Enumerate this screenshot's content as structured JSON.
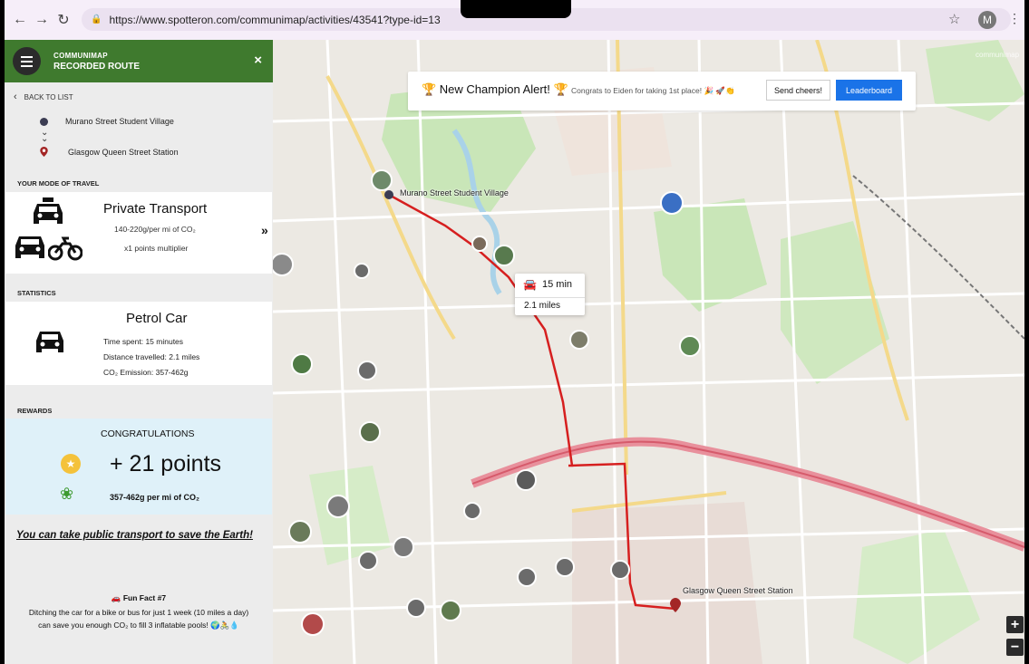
{
  "browser": {
    "url": "https://www.spotteron.com/communimap/activities/43541?type-id=13",
    "profile_initial": "M"
  },
  "sidebar": {
    "app_name": "COMMUNIMAP",
    "title": "RECORDED ROUTE",
    "close_label": "×",
    "back_label": "BACK TO LIST",
    "route": {
      "origin": "Murano Street Student Village",
      "destination": "Glasgow Queen Street Station"
    },
    "mode": {
      "section_label": "YOUR MODE OF TRAVEL",
      "title": "Private Transport",
      "co2": "140-220g/per mi of CO₂",
      "multiplier": "x1 points multiplier",
      "next_label": "»"
    },
    "statistics": {
      "section_label": "STATISTICS",
      "title": "Petrol Car",
      "time": "Time spent: 15 minutes",
      "distance": "Distance travelled: 2.1 miles",
      "emission": "CO₂ Emission: 357-462g"
    },
    "rewards": {
      "section_label": "REWARDS",
      "congrats": "CONGRATULATIONS",
      "points": "+ 21 points",
      "co2": "357-462g per mi of CO₂"
    },
    "tip": "You can take public transport to save the Earth!",
    "fun_fact": {
      "title": "🚗 Fun Fact #7",
      "body": "Ditching the car for a bike or bus for just 1 week (10 miles a day) can save you enough CO₂ to fill 3 inflatable pools! 🌍🚴💧"
    }
  },
  "map": {
    "alert": {
      "title": "🏆 New Champion Alert! 🏆",
      "subtitle": "Congrats to Eiden for taking 1st place! 🎉 🚀👏",
      "cheers_label": "Send cheers!",
      "leaderboard_label": "Leaderboard"
    },
    "tooltip": {
      "time": "15 min",
      "distance": "2.1 miles"
    },
    "labels": {
      "origin": "Murano Street Student Village",
      "destination": "Glasgow Queen Street Station",
      "watermark": "communimap"
    },
    "zoom_in": "+",
    "zoom_out": "−",
    "colors": {
      "route": "#d61f1f",
      "header_green": "#3f7a2e",
      "leaderboard_blue": "#1a73e8"
    }
  }
}
